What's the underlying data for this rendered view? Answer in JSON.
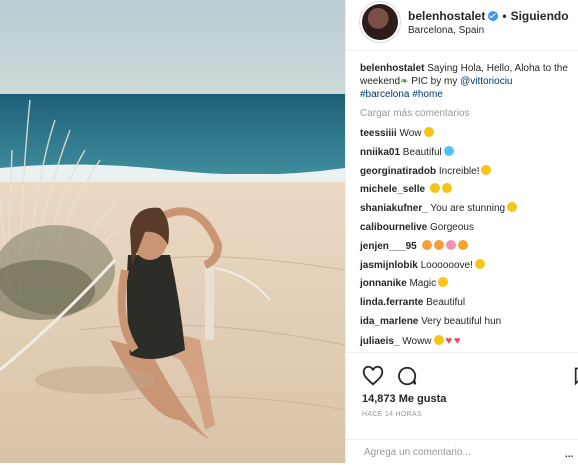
{
  "post": {
    "username": "belenhostalet",
    "follow_sep": "•",
    "follow_label": "Siguiendo",
    "location": "Barcelona, Spain",
    "caption": {
      "username": "belenhostalet",
      "text1": " Saying Hola, Hello, Aloha to the weekend",
      "text2": " PIC by my ",
      "mention": "@vittoriociu",
      "hashtag1": "#barcelona",
      "hashtag2": "#home"
    },
    "load_more": "Cargar más comentarios",
    "comments": [
      {
        "user": "teessiiii",
        "text": " Wow",
        "emoji": [
          "#f5c518"
        ],
        "hearts": 0
      },
      {
        "user": "nniika01",
        "text": " Beautiful",
        "emoji": [
          "#4fc3f7"
        ],
        "hearts": 0
      },
      {
        "user": "georginatiradob",
        "text": " Increible!",
        "emoji": [
          "#f5c518"
        ],
        "hearts": 0
      },
      {
        "user": "michele_selle",
        "text": " ",
        "emoji": [
          "#f5c518",
          "#f5c518"
        ],
        "hearts": 0
      },
      {
        "user": "shaniakufner_",
        "text": " You are stunning",
        "emoji": [
          "#f5c518"
        ],
        "hearts": 0
      },
      {
        "user": "calibournelive",
        "text": " Gorgeous",
        "emoji": [],
        "hearts": 0
      },
      {
        "user": "jenjen___95",
        "text": " ",
        "emoji": [
          "#f59f3a",
          "#f59f3a",
          "#f48fb1",
          "#f5a623"
        ],
        "hearts": 0
      },
      {
        "user": "jasmijnlobik",
        "text": " Loooooove!",
        "emoji": [
          "#f5c518"
        ],
        "hearts": 0
      },
      {
        "user": "jonnanike",
        "text": " Magic",
        "emoji": [
          "#f5c518"
        ],
        "hearts": 0
      },
      {
        "user": "linda.ferrante",
        "text": " Beautiful",
        "emoji": [],
        "hearts": 0
      },
      {
        "user": "ida_marlene",
        "text": " Very beautiful hun",
        "emoji": [],
        "hearts": 0
      },
      {
        "user": "juliaeis_",
        "text": " Woww",
        "emoji": [
          "#f5c518"
        ],
        "hearts": 2
      }
    ],
    "likes": "14,873 Me gusta",
    "time": "HACE 14 HORAS",
    "add_comment_placeholder": "Agrega un comentario...",
    "more_label": "..."
  },
  "icons": {
    "like": "heart-icon",
    "comment": "comment-icon",
    "save": "bookmark-icon",
    "verified": "verified-badge-icon"
  },
  "colors": {
    "link": "#003569",
    "verified": "#3897f0",
    "muted": "#999999",
    "heart": "#ed4956"
  }
}
